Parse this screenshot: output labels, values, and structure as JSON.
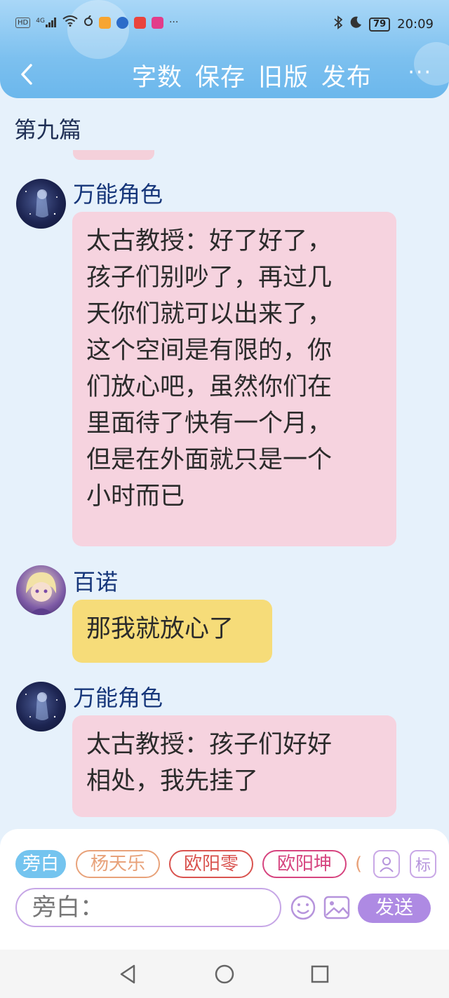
{
  "status_bar": {
    "network_labels": [
      "HD",
      "4G"
    ],
    "time": "20:09",
    "battery": "79",
    "overflow": "···"
  },
  "toolbar": {
    "back_icon": "chevron-left-icon",
    "actions": [
      "字数",
      "保存",
      "旧版",
      "发布"
    ],
    "more": "···"
  },
  "chapter_title": "第九篇",
  "messages": [
    {
      "sender": "万能角色",
      "avatar": "galaxy-girl-avatar",
      "bubble_color": "#f6d3df",
      "lines": [
        "太古教授：好了好了，",
        "孩子们别吵了，再过几",
        "天你们就可以出来了，",
        "这个空间是有限的，你",
        "们放心吧，虽然你们在",
        "里面待了快有一个月，",
        "但是在外面就只是一个",
        "小时而已"
      ]
    },
    {
      "sender": "百诺",
      "avatar": "anime-girl-avatar",
      "bubble_color": "#f6dc79",
      "lines": [
        "那我就放心了"
      ]
    },
    {
      "sender": "万能角色",
      "avatar": "galaxy-girl-avatar",
      "bubble_color": "#f6d3df",
      "lines": [
        "太古教授：孩子们好好",
        "相处，我先挂了"
      ]
    }
  ],
  "input_panel": {
    "roles": [
      {
        "label": "旁白",
        "active": true,
        "color": "#74c4ef"
      },
      {
        "label": "杨天乐",
        "active": false,
        "color": "#e8a27a"
      },
      {
        "label": "欧阳零",
        "active": false,
        "color": "#d9534f"
      },
      {
        "label": "欧阳坤",
        "active": false,
        "color": "#d6447f"
      }
    ],
    "role_overflow": "(",
    "tag_button": "标",
    "placeholder": "旁白：",
    "send_label": "发送",
    "icons": [
      "contact-card-icon",
      "tag-icon",
      "emoji-icon",
      "image-icon"
    ]
  },
  "nav_bar": {
    "icons": [
      "back-triangle-icon",
      "home-circle-icon",
      "recents-square-icon"
    ]
  },
  "colors": {
    "header_gradient_top": "#a9d7f7",
    "header_gradient_bottom": "#6bb7ec",
    "page_background": "#e6f1fb",
    "sender_name": "#16367a",
    "accent_purple": "#ae8ae3"
  }
}
